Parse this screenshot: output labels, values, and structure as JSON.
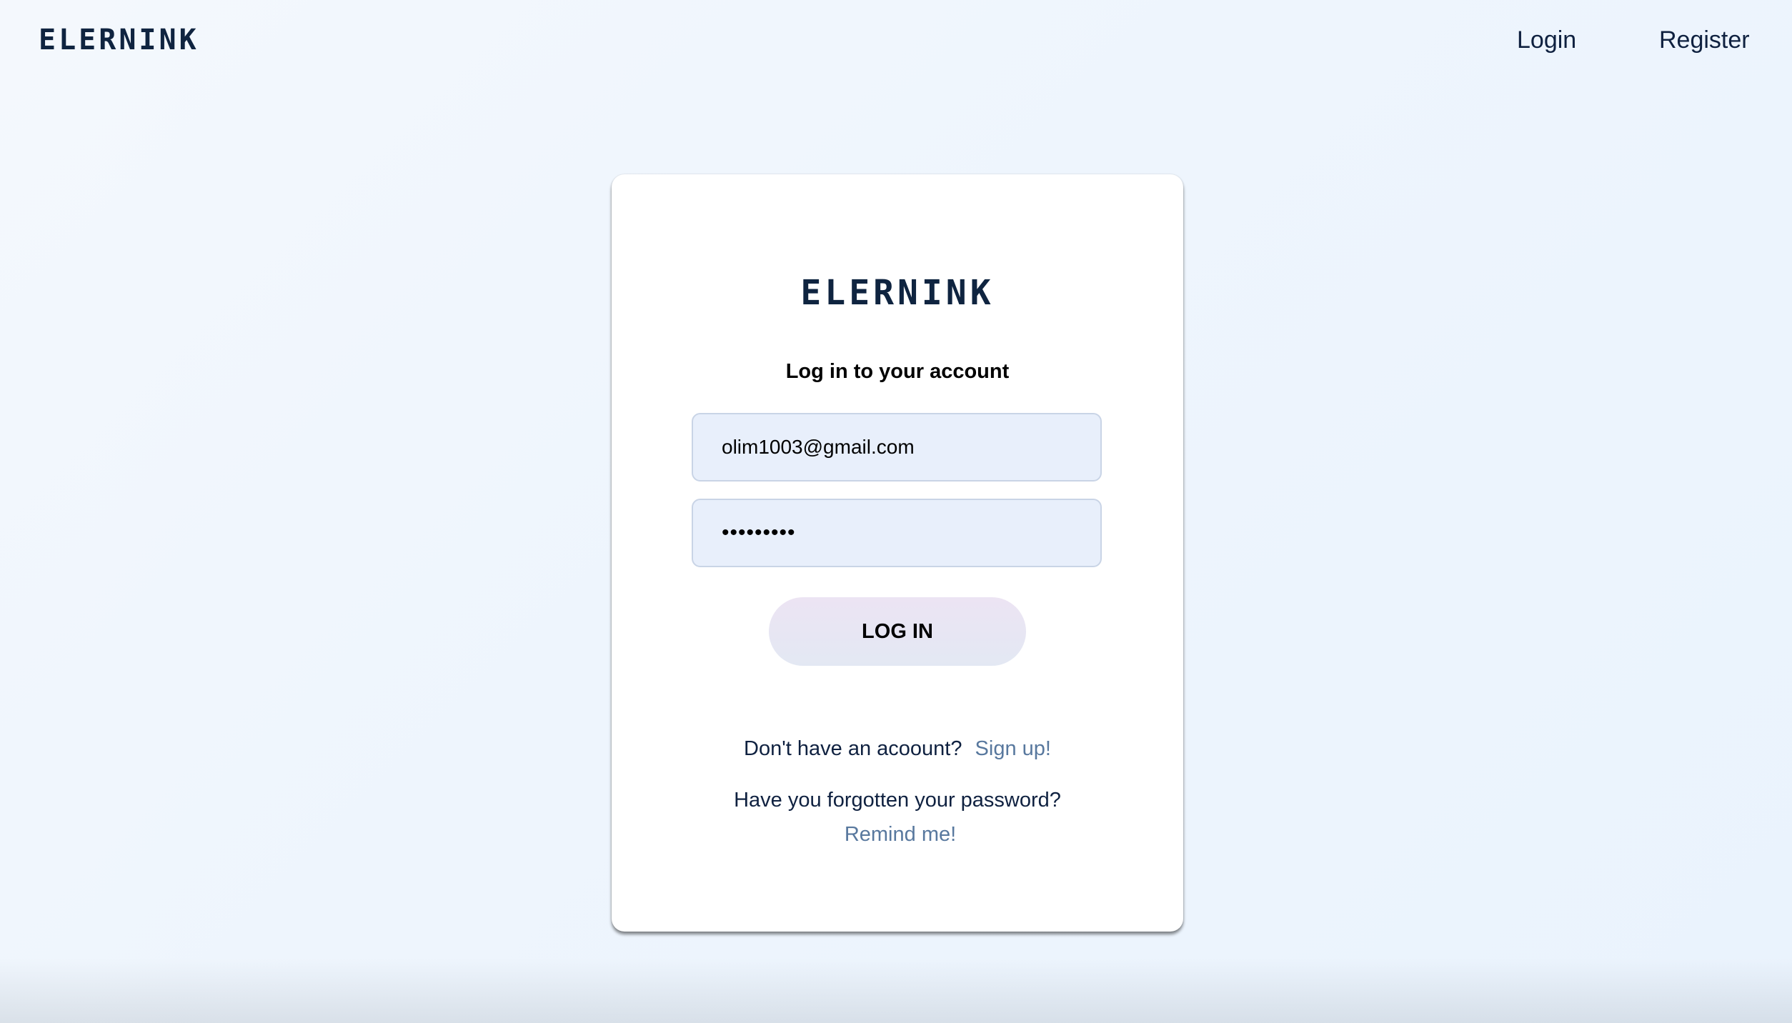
{
  "header": {
    "logo": "ELERNINK",
    "nav": {
      "login": "Login",
      "register": "Register"
    }
  },
  "card": {
    "logo": "ELERNINK",
    "title": "Log in to your account",
    "email_value": "olim1003@gmail.com",
    "password_value": "*********",
    "login_button": "LOG IN",
    "signup_prompt": "Don't have an acoount?",
    "signup_link": "Sign up!",
    "forgot_prompt": "Have you forgotten your password?",
    "remind_link": "Remind me!"
  },
  "colors": {
    "brand_dark": "#0f2440",
    "link": "#58789e",
    "field_bg": "#e8effb"
  }
}
